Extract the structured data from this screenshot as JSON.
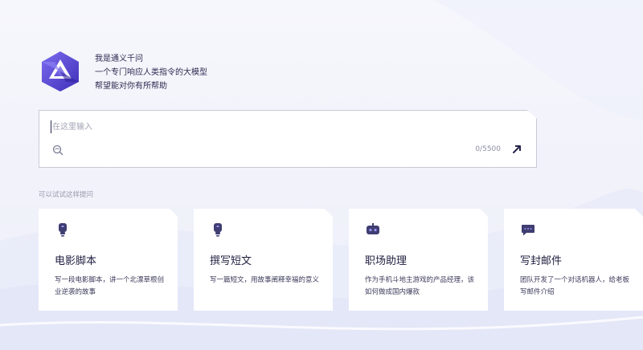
{
  "intro": {
    "lines": [
      "我是通义千问",
      "一个专门响应人类指令的大模型",
      "帮望能对你有所帮助"
    ]
  },
  "input": {
    "placeholder": "在这里输入",
    "value": "",
    "counter": "0/5500"
  },
  "suggestions": {
    "label": "可以试试这样提问",
    "cards": [
      {
        "icon": "lightbulb-icon",
        "title": "电影脚本",
        "desc": "写一段电影脚本，讲一个北漂草根创业逆袭的故事"
      },
      {
        "icon": "lightbulb-icon",
        "title": "撰写短文",
        "desc": "写一篇短文，用故事阐释幸福的意义"
      },
      {
        "icon": "robot-icon",
        "title": "职场助理",
        "desc": "作为手机斗地主游戏的产品经理，该如何做成国内爆款"
      },
      {
        "icon": "chat-bubble-icon",
        "title": "写封邮件",
        "desc": "团队开发了一个对话机器人，给老板写邮件介绍"
      }
    ]
  },
  "colors": {
    "accent": "#5b4bd6",
    "text": "#26244c",
    "icon": "#3f3d72"
  }
}
